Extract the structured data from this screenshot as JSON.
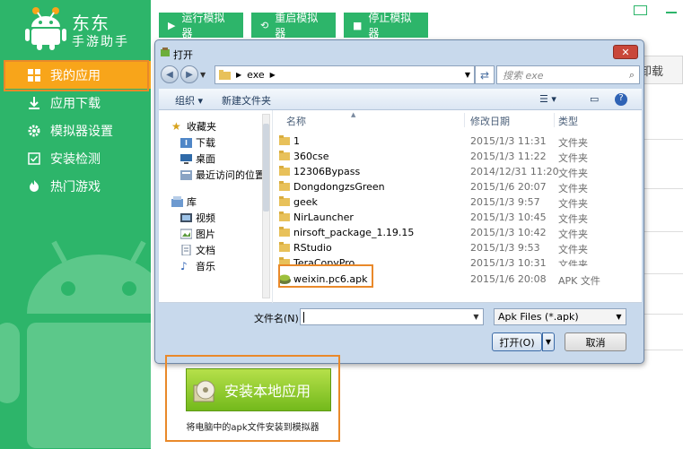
{
  "app": {
    "name_line1": "东东",
    "name_line2": "手游助手",
    "accent": "#2db56a",
    "active": "#f8a51a",
    "highlight": "#e9892a"
  },
  "sidebar": {
    "items": [
      {
        "label": "我的应用",
        "icon": "grid-icon"
      },
      {
        "label": "应用下载",
        "icon": "download-icon"
      },
      {
        "label": "模拟器设置",
        "icon": "gear-icon"
      },
      {
        "label": "安装检测",
        "icon": "check-box-icon"
      },
      {
        "label": "热门游戏",
        "icon": "hot-game-icon"
      }
    ]
  },
  "topbar": {
    "run": "运行模拟器",
    "restart": "重启模拟器",
    "stop": "停止模拟器"
  },
  "background": {
    "partial_button": "卸载"
  },
  "dialog": {
    "title": "打开",
    "path": [
      "exe"
    ],
    "search_placeholder": "搜索 exe",
    "toolbar": {
      "organize": "组织 ▾",
      "new_folder": "新建文件夹"
    },
    "tree": {
      "favorites": "收藏夹",
      "fav_items": [
        "下载",
        "桌面",
        "最近访问的位置"
      ],
      "library": "库",
      "lib_items": [
        "视频",
        "图片",
        "文档",
        "音乐"
      ]
    },
    "columns": {
      "name": "名称",
      "date": "修改日期",
      "type": "类型"
    },
    "files": [
      {
        "name": "1",
        "date": "2015/1/3 11:31",
        "type": "文件夹"
      },
      {
        "name": "360cse",
        "date": "2015/1/3 11:22",
        "type": "文件夹"
      },
      {
        "name": "12306Bypass",
        "date": "2014/12/31 11:20",
        "type": "文件夹"
      },
      {
        "name": "DongdongzsGreen",
        "date": "2015/1/6 20:07",
        "type": "文件夹"
      },
      {
        "name": "geek",
        "date": "2015/1/3 9:57",
        "type": "文件夹"
      },
      {
        "name": "NirLauncher",
        "date": "2015/1/3 10:45",
        "type": "文件夹"
      },
      {
        "name": "nirsoft_package_1.19.15",
        "date": "2015/1/3 10:42",
        "type": "文件夹"
      },
      {
        "name": "RStudio",
        "date": "2015/1/3 9:53",
        "type": "文件夹"
      },
      {
        "name": "TeraCopyPro",
        "date": "2015/1/3 10:31",
        "type": "文件夹"
      },
      {
        "name": "weixin.pc6.apk",
        "date": "2015/1/6 20:08",
        "type": "APK 文件"
      }
    ],
    "filename_label": "文件名(N):",
    "filename_value": "",
    "filetype": "Apk Files (*.apk)",
    "open": "打开(O)",
    "cancel": "取消"
  },
  "install": {
    "button": "安装本地应用",
    "note": "将电脑中的apk文件安装到模拟器"
  }
}
